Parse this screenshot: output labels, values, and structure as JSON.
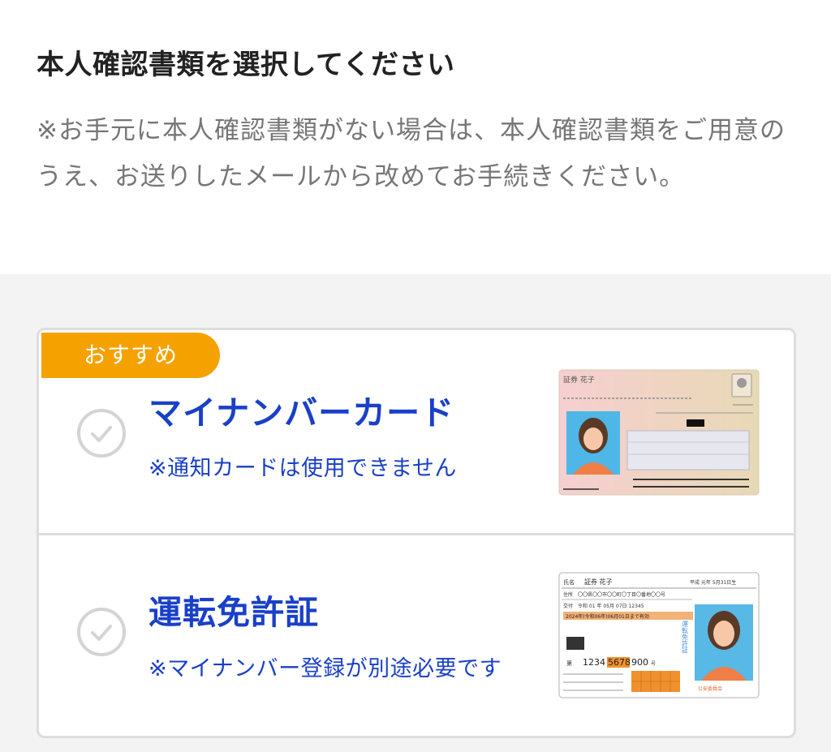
{
  "header": {
    "title": "本人確認書類を選択してください",
    "note": "※お手元に本人確認書類がない場合は、本人確認書類をご用意のうえ、お送りしたメールから改めてお手続きください。"
  },
  "options": [
    {
      "badge": "おすすめ",
      "title": "マイナンバーカード",
      "subtitle": "※通知カードは使用できません",
      "icon": "my-number-card-illustration",
      "card": {
        "name": "証券 花子"
      }
    },
    {
      "title": "運転免許証",
      "subtitle": "※マイナンバー登録が別途必要です",
      "icon": "drivers-license-illustration",
      "card": {
        "name_label": "氏名",
        "name": "証券 花子",
        "birth": "平成 元年 5月31日生",
        "address_label": "住所",
        "address": "〇〇県〇〇市〇〇町〇丁目〇番地〇〇号",
        "issue_label": "交付",
        "issue": "令和 01 年 05月 07日 12345",
        "expiry": "2024年(令和06年)06月01日まで有効",
        "number_prefix": "第",
        "number_a": "1234",
        "number_b": "5678",
        "number_c": "900",
        "number_suffix": "号",
        "vertical": "運転免許証",
        "authority": "公安委員会"
      }
    }
  ],
  "colors": {
    "accent_blue": "#1a40c8",
    "badge_orange": "#f5a200"
  }
}
